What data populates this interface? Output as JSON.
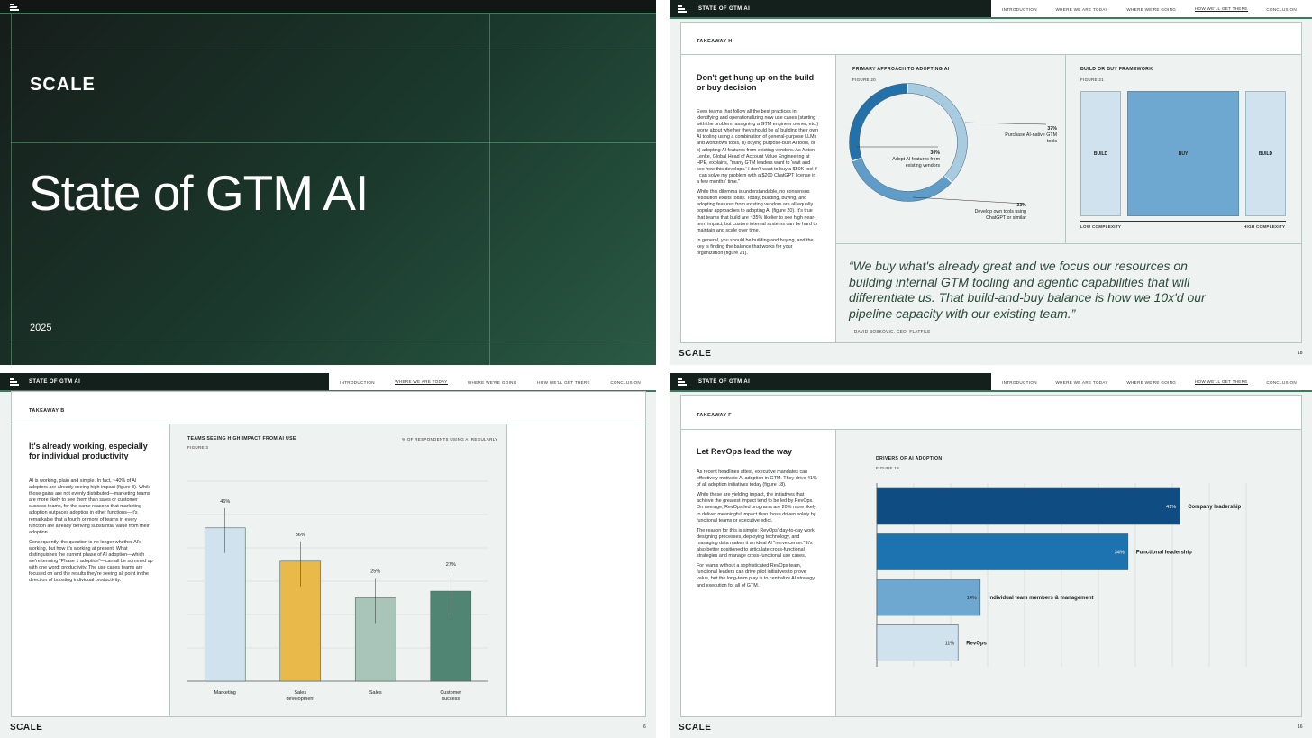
{
  "cover": {
    "logo": "SCALE",
    "title": "State of GTM AI",
    "year": "2025"
  },
  "nav": {
    "section_label": "STATE OF GTM AI",
    "items": [
      "INTRODUCTION",
      "WHERE WE ARE TODAY",
      "WHERE WE'RE GOING",
      "HOW WE'LL GET THERE",
      "CONCLUSION"
    ]
  },
  "slide18": {
    "takeaway": "TAKEAWAY H",
    "heading": "Don't get hung up on the build or buy decision",
    "paragraphs": [
      "Even teams that follow all the best practices in identifying and operationalizing new use cases (starting with the problem, assigning a GTM engineer owner, etc.) worry about whether they should be a) building their own AI tooling using a combination of general-purpose LLMs and workflows tools, b) buying purpose-built AI tools, or c) adopting AI features from existing vendors. As Anton Lenke, Global Head of Account Value Engineering at HPE, explains, \"many GTM leaders want to 'wait and see how this develops.' I don't want to buy a $50K tool if I can solve my problem with a $200 ChatGPT license in a few months' time.\"",
      "While this dilemma is understandable, no consensus resolution exists today. Today, building, buying, and adopting features from existing vendors are all equally popular approaches to adopting AI (figure 20). It's true that teams that build are ~35% likelier to see high near-term impact, but custom internal systems can be hard to maintain and scale over time.",
      "In general, you should be building and buying, and the key is finding the balance that works for your organization (figure 21)."
    ],
    "donut": {
      "title": "PRIMARY APPROACH TO ADOPTING AI",
      "figure": "FIGURE 20",
      "slices": [
        {
          "pct": "37%",
          "label": "Purchase AI-native GTM tools",
          "value": 37,
          "color": "#a9cbe0"
        },
        {
          "pct": "33%",
          "label": "Develop own tools using ChatGPT or similar",
          "value": 33,
          "color": "#5f9cc7"
        },
        {
          "pct": "30%",
          "label": "Adopt AI features from existing vendors",
          "value": 30,
          "color": "#2470a8"
        }
      ]
    },
    "framework": {
      "title": "BUILD OR BUY FRAMEWORK",
      "figure": "FIGURE 21",
      "blocks": [
        "BUILD",
        "BUY",
        "BUILD"
      ],
      "low": "LOW COMPLEXITY",
      "high": "HIGH COMPLEXITY"
    },
    "quote": "“We buy what's already great and we focus our resources on building internal GTM tooling and agentic capabilities that will differentiate us. That build-and-buy balance is how we 10x'd our pipeline capacity with our existing team.”",
    "attribution": "DAVID BOSKOVIC, CEO, FLATFILE",
    "logo": "SCALE",
    "page": "18"
  },
  "slide6": {
    "takeaway": "TAKEAWAY B",
    "heading": "It's already working, especially for individual productivity",
    "paragraphs": [
      "AI is working, plain and simple. In fact, ~40% of AI adopters are already seeing high impact (figure 3). While those gains are not evenly distributed—marketing teams are more likely to see them than sales or customer success teams, for the same reasons that marketing adoption outpaces adoption in other functions—it's remarkable that a fourth or more of teams in every function are already deriving substantial value from their adoption.",
      "Consequently, the question is no longer whether AI's working, but how it's working at present. What distinguishes the current phase of AI adoption—which we're terming \"Phase 1 adoption\"—can all be summed up with one word: productivity. The use cases teams are focused on and the results they're seeing all point in the direction of boosting individual productivity."
    ],
    "logo": "SCALE",
    "page": "6"
  },
  "slide16": {
    "takeaway": "TAKEAWAY F",
    "heading": "Let RevOps lead the way",
    "paragraphs": [
      "As recent headlines attest, executive mandates can effectively motivate AI adoption in GTM. They drive 41% of all adoption initiatives today (figure 18).",
      "While these are yielding impact, the initiatives that achieve the greatest impact tend to be led by RevOps. On average, RevOps-led programs are 20% more likely to deliver meaningful impact than those driven solely by functional teams or executive edict.",
      "The reason for this is simple: RevOps' day-to-day work designing processes, deploying technology, and managing data makes it an ideal AI \"nerve center.\" It's also better positioned to articulate cross-functional strategies and manage cross-functional use cases.",
      "For teams without a sophisticated RevOps team, functional leaders can drive pilot initiatives to prove value, but the long-term play is to centralize AI strategy and execution for all of GTM."
    ],
    "logo": "SCALE",
    "page": "16"
  },
  "chart_data": [
    {
      "type": "bar",
      "title": "TEAMS SEEING HIGH IMPACT FROM AI USE",
      "subtitle": "% OF RESPONDENTS USING AI REGULARLY",
      "figure": "FIGURE 3",
      "categories": [
        "Marketing",
        "Sales development",
        "Sales",
        "Customer success"
      ],
      "values": [
        46,
        36,
        25,
        27
      ],
      "labels": [
        "46%",
        "36%",
        "25%",
        "27%"
      ],
      "colors": [
        "#cfe2ee",
        "#e9b949",
        "#a9c4b8",
        "#4f8572"
      ],
      "ylim": [
        0,
        60
      ],
      "grid": true
    },
    {
      "type": "bar",
      "orientation": "horizontal",
      "title": "DRIVERS OF AI ADOPTION",
      "figure": "FIGURE 18",
      "categories": [
        "Company leadership",
        "Functional leadership",
        "Individual team members & management",
        "RevOps"
      ],
      "values": [
        41,
        34,
        14,
        11
      ],
      "labels": [
        "41%",
        "34%",
        "14%",
        "11%"
      ],
      "colors": [
        "#0f4c81",
        "#1d72b0",
        "#6ea7cf",
        "#cfe2ee"
      ],
      "xlim": [
        0,
        50
      ],
      "grid": true
    }
  ]
}
